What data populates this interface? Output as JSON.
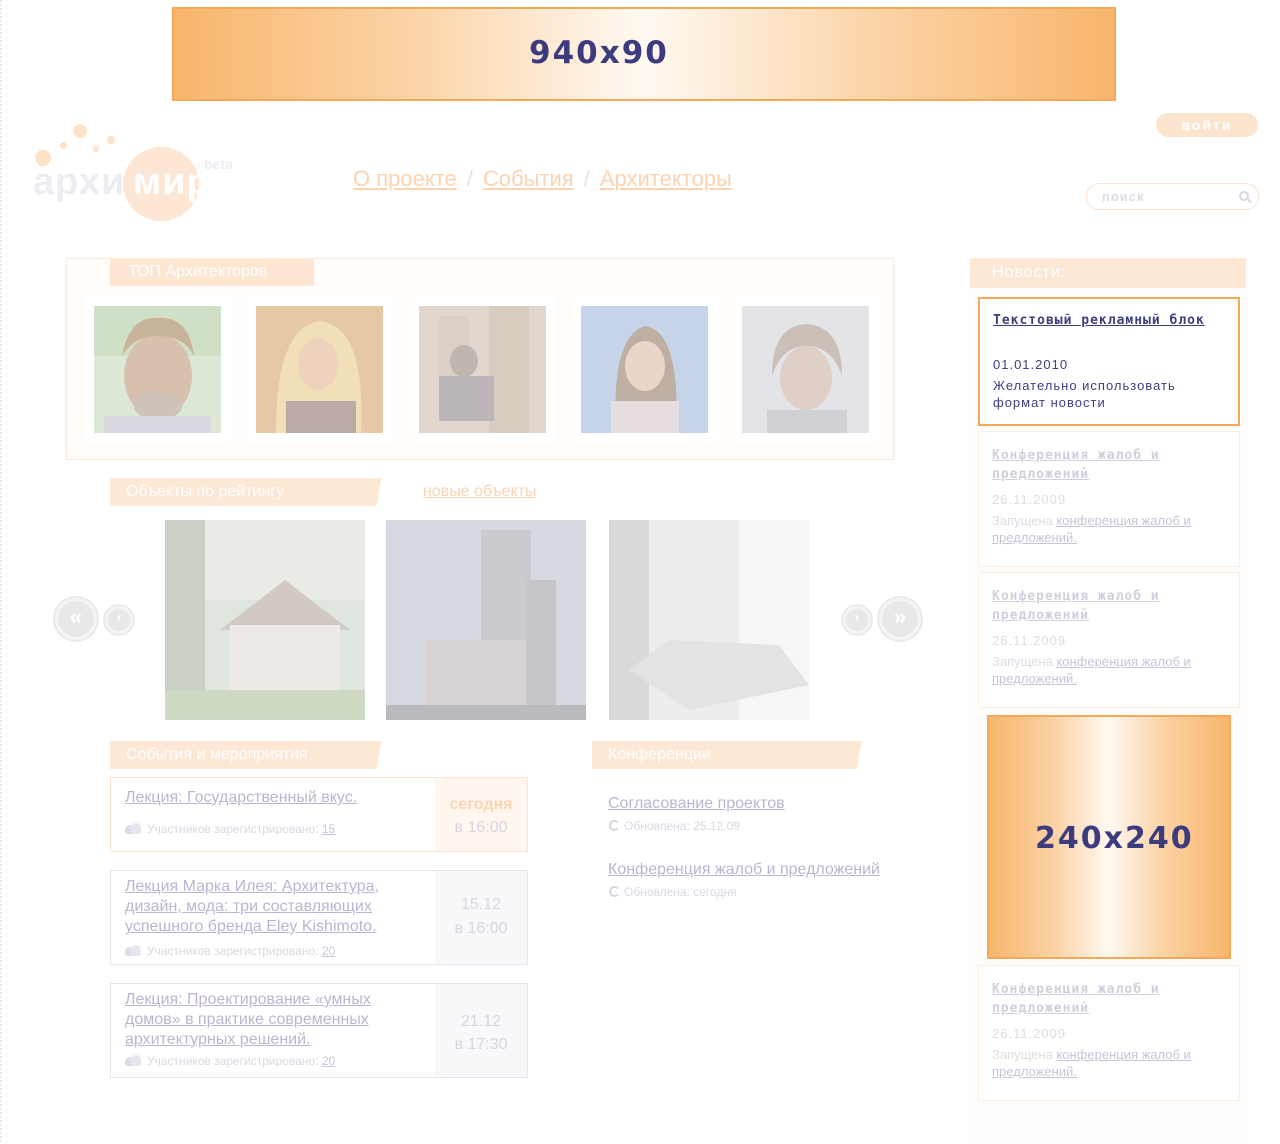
{
  "banners": {
    "top": "940x90",
    "side": "240x240"
  },
  "header": {
    "login_label": "войти",
    "logo": {
      "part_a": "архи",
      "part_b": "мир",
      "badge": "beta"
    },
    "nav": [
      {
        "label": "О проекте"
      },
      {
        "label": "События"
      },
      {
        "label": "Архитекторы"
      }
    ],
    "nav_separator": "/",
    "search_placeholder": "поиск"
  },
  "top_architects": {
    "title": "ТОП Архитекторов"
  },
  "objects": {
    "title": "Объекты по рейтингу",
    "new_link": "новые объекты"
  },
  "events": {
    "title": "События и мероприятия",
    "participants_label": "Участников зарегистрировано:",
    "items": [
      {
        "title": "Лекция: Государственный вкус.",
        "date": "сегодня",
        "time": "в 16:00",
        "count": "15"
      },
      {
        "title": "Лекция Марка Илея: Архитектура, дизайн, мода: три составляющих успешного бренда Eley Kishimoto.",
        "date": "15.12",
        "time": "в 16:00",
        "count": "20"
      },
      {
        "title": "Лекция: Проектирование «умных домов» в практике современных архитектурных решений.",
        "date": "21.12",
        "time": "в 17:30",
        "count": "20"
      }
    ]
  },
  "conferences": {
    "title": "Конференции",
    "items": [
      {
        "title": "Согласование проектов",
        "meta": "Обновлена: 25.12.09"
      },
      {
        "title": "Конференция жалоб и предложений",
        "meta": "Обновлена: сегодня"
      }
    ]
  },
  "news": {
    "title": "Новости:",
    "ad": {
      "title": "Текстовый рекламный блок",
      "date": "01.01.2010",
      "text": "Желательно использовать формат новости"
    },
    "items": [
      {
        "title": "Конференция жалоб и предложений",
        "date": "26.11.2009",
        "prefix": "Запущена",
        "link": "конференция жалоб и предложений."
      },
      {
        "title": "Конференция жалоб и предложений",
        "date": "26.11.2009",
        "prefix": "Запущена",
        "link": "конференция жалоб и предложений."
      },
      {
        "title": "Конференция жалоб и предложений",
        "date": "26.11.2009",
        "prefix": "Запущена",
        "link": "конференция жалоб и предложений."
      }
    ]
  },
  "colors": {
    "accent": "#f4a95a",
    "accent_light": "#fde8d6",
    "link": "#b7b7d2",
    "banner_text": "#3b3b7e"
  }
}
